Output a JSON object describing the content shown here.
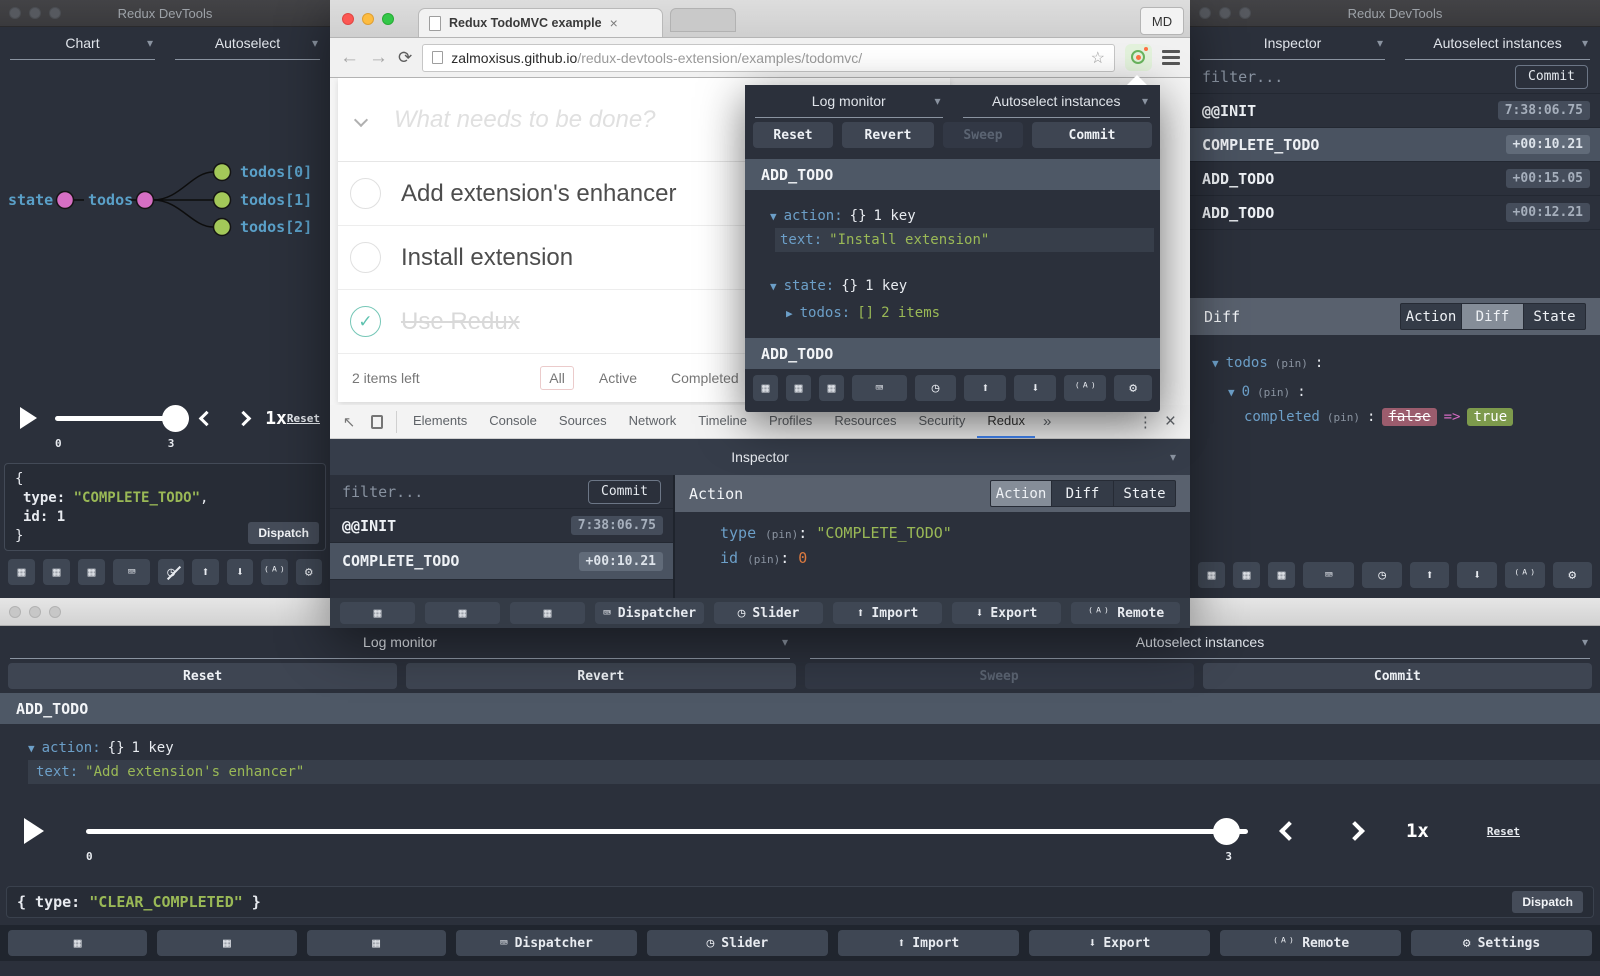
{
  "colors": {
    "accent_blue": "#6c9fc8",
    "string_green": "#9ab956",
    "number_orange": "#dd7a3f",
    "diff_removed_bg": "#9b5c6d",
    "diff_added_bg": "#7d9a4c",
    "diff_arrow_pink": "#d36ac1",
    "devtools_tab_accent": "#4285f4",
    "chart_node_pink": "#d66fc3",
    "chart_node_green": "#a3c859"
  },
  "icons": {
    "grid": "▦",
    "dispatcher": "⌨",
    "slider": "◷",
    "import": "⬆",
    "export": "⬇",
    "remote": "⁽ᴬ⁾",
    "settings": "⚙",
    "play": "▶",
    "arrow_down": "▾",
    "tree_open": "▼",
    "tree_closed": "▶",
    "star": "☆",
    "more_tabs": "»",
    "kebab": "⋮",
    "close": "×",
    "back": "←",
    "forward": "→",
    "reload": "⟳",
    "check": "✓",
    "inspect": "↖"
  },
  "left_window": {
    "title": "Redux DevTools",
    "monitor_select": "Chart",
    "instance_select": "Autoselect",
    "chart": {
      "root_label": "state",
      "branch_label": "todos",
      "leaves": [
        "todos[0]",
        "todos[1]",
        "todos[2]"
      ]
    },
    "player": {
      "tick_start": "0",
      "tick_end": "3",
      "speed": "1x",
      "reset": "Reset"
    },
    "dispatch": {
      "line_open": "{",
      "type_key": "type:",
      "type_value": "\"COMPLETE_TODO\"",
      "comma": ",",
      "id_line": "id: 1",
      "line_close": "}",
      "button": "Dispatch"
    }
  },
  "browser": {
    "tab_title": "Redux TodoMVC example",
    "profile_badge": "MD",
    "url_host": "zalmoxisus.github.io",
    "url_path": "/redux-devtools-extension/examples/todomvc/",
    "todomvc": {
      "placeholder": "What needs to be done?",
      "items": [
        {
          "label": "Add extension's enhancer",
          "completed": false
        },
        {
          "label": "Install extension",
          "completed": false
        },
        {
          "label": "Use Redux",
          "completed": true
        }
      ],
      "items_left": "2 items left",
      "filters": [
        "All",
        "Active",
        "Completed"
      ],
      "active_filter": "All"
    },
    "devtools": {
      "tabs": [
        "Elements",
        "Console",
        "Sources",
        "Network",
        "Timeline",
        "Profiles",
        "Resources",
        "Security",
        "Redux"
      ],
      "active_tab": "Redux",
      "inspector_title": "Inspector",
      "filter_placeholder": "filter...",
      "commit_button": "Commit",
      "action_list": [
        {
          "name": "@@INIT",
          "time": "7:38:06.75"
        },
        {
          "name": "COMPLETE_TODO",
          "time": "+00:10.21"
        }
      ],
      "panel_title": "Action",
      "panel_tabs": [
        "Action",
        "Diff",
        "State"
      ],
      "panel_active": "Action",
      "action_tree": {
        "type_key": "type",
        "pin": "(pin)",
        "colon": ":",
        "type_value": "\"COMPLETE_TODO\"",
        "id_key": "id",
        "id_value": "0"
      },
      "toolbar": {
        "dispatcher": "Dispatcher",
        "slider": "Slider",
        "import": "Import",
        "export": "Export",
        "remote": "Remote"
      }
    }
  },
  "popup": {
    "monitor_select": "Log monitor",
    "instance_select": "Autoselect instances",
    "buttons": {
      "reset": "Reset",
      "revert": "Revert",
      "sweep": "Sweep",
      "commit": "Commit"
    },
    "entry1": {
      "name": "ADD_TODO",
      "action_key": "action:",
      "action_braces": "{}",
      "action_meta": "1 key",
      "text_key": "text:",
      "text_value": "\"Install extension\"",
      "state_key": "state:",
      "state_braces": "{}",
      "state_meta": "1 key",
      "todos_key": "todos:",
      "todos_brackets": "[]",
      "todos_meta": "2 items"
    },
    "entry2": {
      "name": "ADD_TODO"
    }
  },
  "right_window": {
    "title": "Redux DevTools",
    "monitor_select": "Inspector",
    "instance_select": "Autoselect instances",
    "filter_placeholder": "filter...",
    "commit_button": "Commit",
    "action_list": [
      {
        "name": "@@INIT",
        "time": "7:38:06.75"
      },
      {
        "name": "COMPLETE_TODO",
        "time": "+00:10.21"
      },
      {
        "name": "ADD_TODO",
        "time": "+00:15.05"
      },
      {
        "name": "ADD_TODO",
        "time": "+00:12.21"
      }
    ],
    "panel_title": "Diff",
    "panel_tabs": [
      "Action",
      "Diff",
      "State"
    ],
    "panel_active": "Diff",
    "diff_tree": {
      "todos_key": "todos",
      "pin": "(pin)",
      "colon": ":",
      "index_key": "0",
      "completed_key": "completed",
      "old_value": "false",
      "arrow": "=>",
      "new_value": "true"
    }
  },
  "bottom_window": {
    "monitor_select": "Log monitor",
    "instance_select": "Autoselect instances",
    "buttons": {
      "reset": "Reset",
      "revert": "Revert",
      "sweep": "Sweep",
      "commit": "Commit"
    },
    "entry": {
      "name": "ADD_TODO",
      "action_key": "action:",
      "action_braces": "{}",
      "action_meta": "1 key",
      "text_key": "text:",
      "text_value": "\"Add extension's enhancer\""
    },
    "player": {
      "tick_start": "0",
      "tick_end": "3",
      "speed": "1x",
      "reset": "Reset"
    },
    "dispatch": {
      "code_prefix": "{ type: ",
      "code_value": "\"CLEAR_COMPLETED\"",
      "code_suffix": " }",
      "button": "Dispatch"
    },
    "toolbar": {
      "dispatcher": "Dispatcher",
      "slider": "Slider",
      "import": "Import",
      "export": "Export",
      "remote": "Remote",
      "settings": "Settings"
    }
  }
}
